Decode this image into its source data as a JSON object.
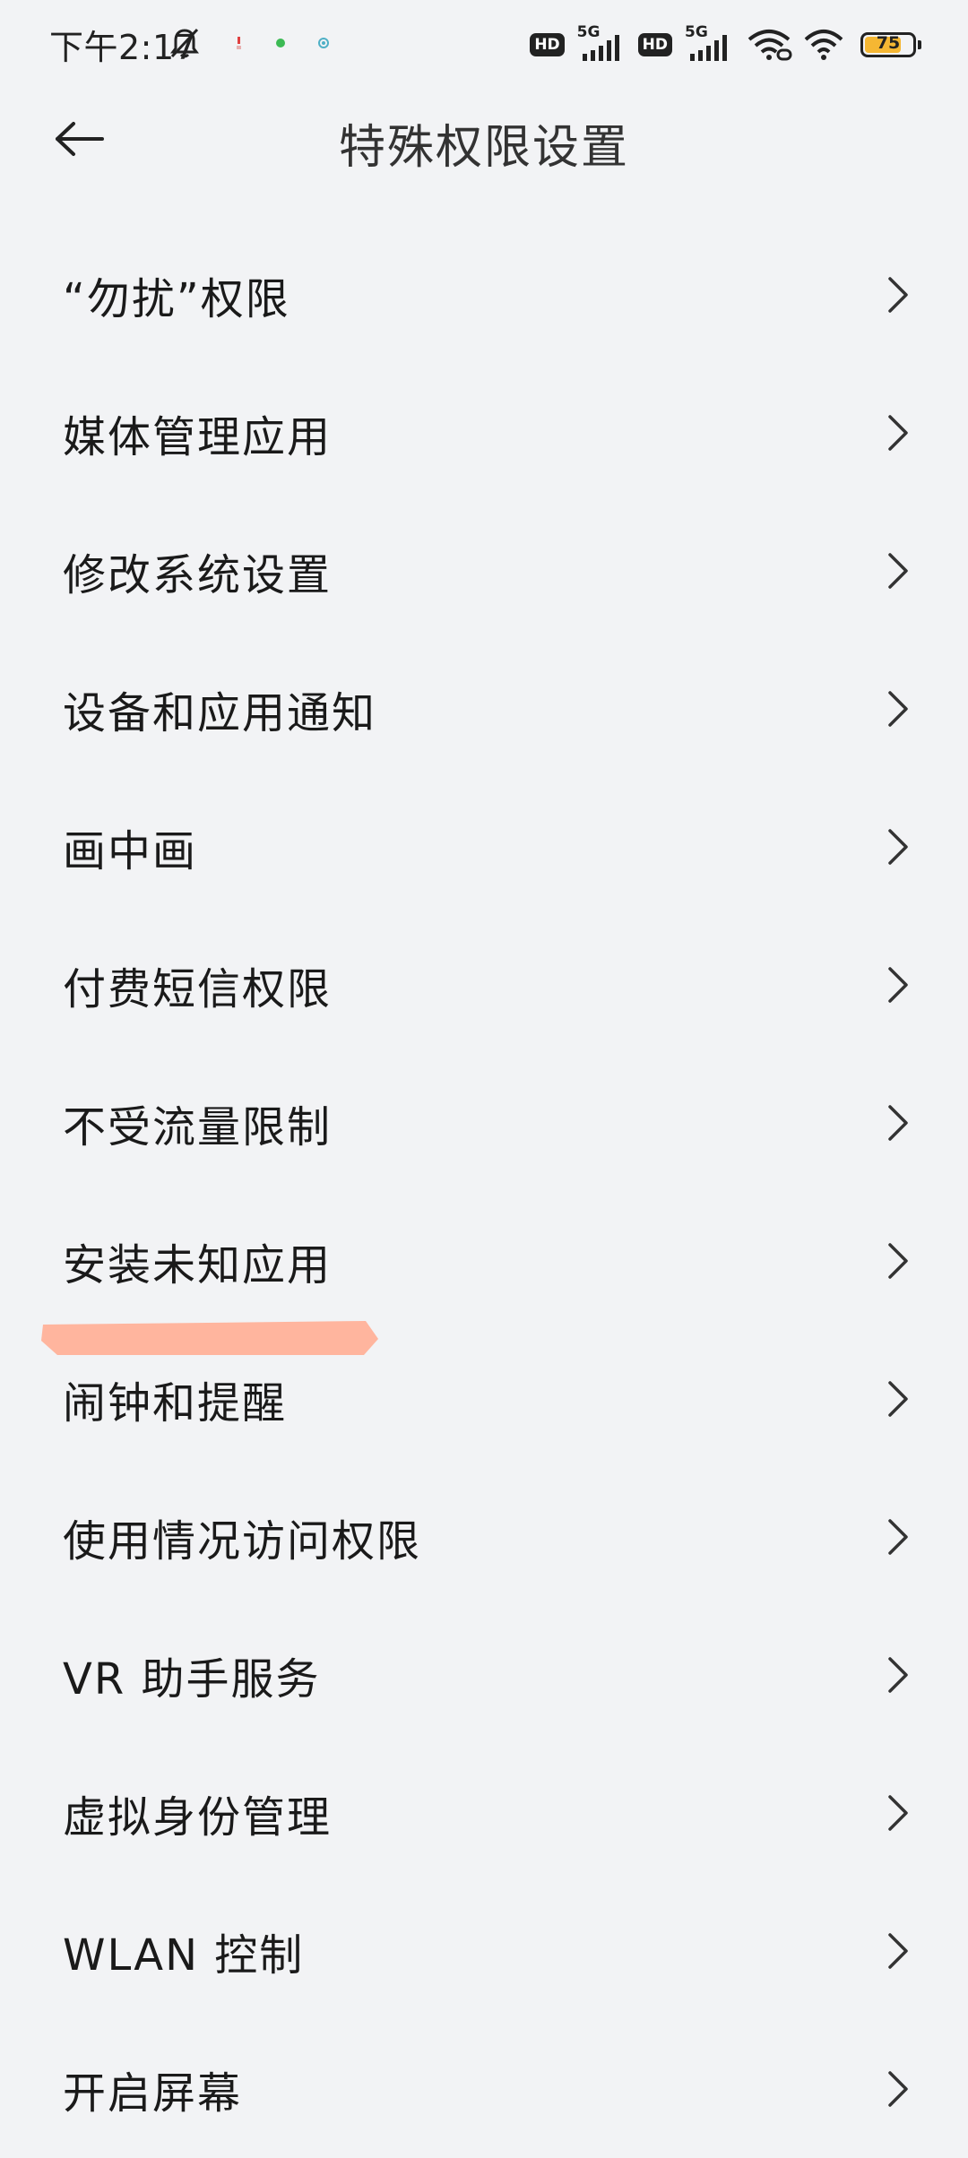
{
  "status_bar": {
    "time": "下午2:17",
    "network_badge_1": "HD",
    "network_type_1": "5G",
    "network_badge_2": "HD",
    "network_type_2": "5G",
    "battery_level": "75",
    "battery_color": "#f5b733"
  },
  "header": {
    "back_icon": "arrow-left-icon",
    "title": "特殊权限设置"
  },
  "list": {
    "items": [
      {
        "label": "“勿扰”权限"
      },
      {
        "label": "媒体管理应用"
      },
      {
        "label": "修改系统设置"
      },
      {
        "label": "设备和应用通知"
      },
      {
        "label": "画中画"
      },
      {
        "label": "付费短信权限"
      },
      {
        "label": "不受流量限制"
      },
      {
        "label": "安装未知应用"
      },
      {
        "label": "闹钟和提醒"
      },
      {
        "label": "使用情况访问权限"
      },
      {
        "label": "VR 助手服务"
      },
      {
        "label": "虚拟身份管理"
      },
      {
        "label": "WLAN 控制"
      },
      {
        "label": "开启屏幕"
      }
    ],
    "chevron_icon": "chevron-right-icon"
  },
  "annotation": {
    "highlight_color": "#ffb59e"
  }
}
